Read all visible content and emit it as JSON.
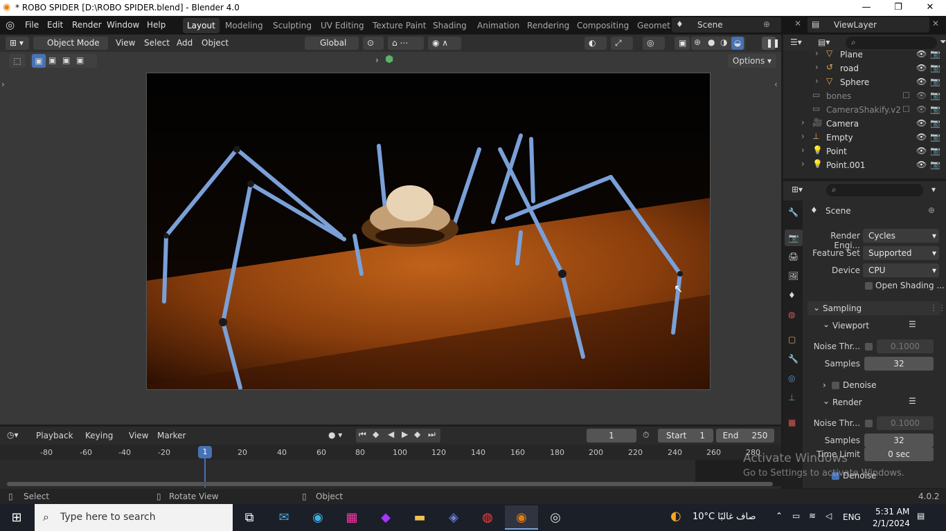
{
  "window": {
    "title": "* ROBO SPIDER [D:\\ROBO SPIDER.blend] - Blender 4.0"
  },
  "menus": [
    "File",
    "Edit",
    "Render",
    "Window",
    "Help"
  ],
  "workspaces": [
    "Layout",
    "Modeling",
    "Sculpting",
    "UV Editing",
    "Texture Paint",
    "Shading",
    "Animation",
    "Rendering",
    "Compositing",
    "Geomet"
  ],
  "scene": {
    "name": "Scene",
    "view_layer": "ViewLayer"
  },
  "viewport_header": {
    "mode": "Object Mode",
    "view": "View",
    "select": "Select",
    "add": "Add",
    "object": "Object",
    "orientation": "Global",
    "options": "Options"
  },
  "outliner": {
    "items": [
      {
        "name": "Plane"
      },
      {
        "name": "road"
      },
      {
        "name": "Sphere"
      },
      {
        "name": "bones"
      },
      {
        "name": "CameraShakify.v2"
      },
      {
        "name": "Camera"
      },
      {
        "name": "Empty"
      },
      {
        "name": "Point"
      },
      {
        "name": "Point.001"
      }
    ]
  },
  "properties": {
    "context": "Scene",
    "render_engine_label": "Render Engi...",
    "render_engine": "Cycles",
    "feature_set_label": "Feature Set",
    "feature_set": "Supported",
    "device_label": "Device",
    "device": "CPU",
    "open_shading": "Open Shading ...",
    "sampling": "Sampling",
    "viewport": "Viewport",
    "noise_label": "Noise Thr...",
    "viewport_noise": "0.1000",
    "samples_label": "Samples",
    "viewport_samples": "32",
    "denoise": "Denoise",
    "render": "Render",
    "render_noise": "0.1000",
    "render_samples": "32",
    "time_limit_label": "Time Limit",
    "time_limit": "0 sec"
  },
  "timeline": {
    "playback": "Playback",
    "keying": "Keying",
    "view": "View",
    "marker": "Marker",
    "current_frame": "1",
    "start_label": "Start",
    "start": "1",
    "end_label": "End",
    "end": "250",
    "ticks": [
      "-80",
      "-60",
      "-40",
      "-20",
      "1",
      "20",
      "40",
      "60",
      "80",
      "100",
      "120",
      "140",
      "160",
      "180",
      "200",
      "220",
      "240",
      "260",
      "280"
    ]
  },
  "status": {
    "select": "Select",
    "rotate": "Rotate View",
    "object": "Object",
    "version": "4.0.2"
  },
  "watermark": {
    "line1": "Activate Windows",
    "line2": "Go to Settings to activate Windows."
  },
  "taskbar": {
    "search_placeholder": "Type here to search",
    "weather": "10°C  صاف غالبًا",
    "lang": "ENG",
    "time": "5:31 AM",
    "date": "2/1/2024"
  }
}
